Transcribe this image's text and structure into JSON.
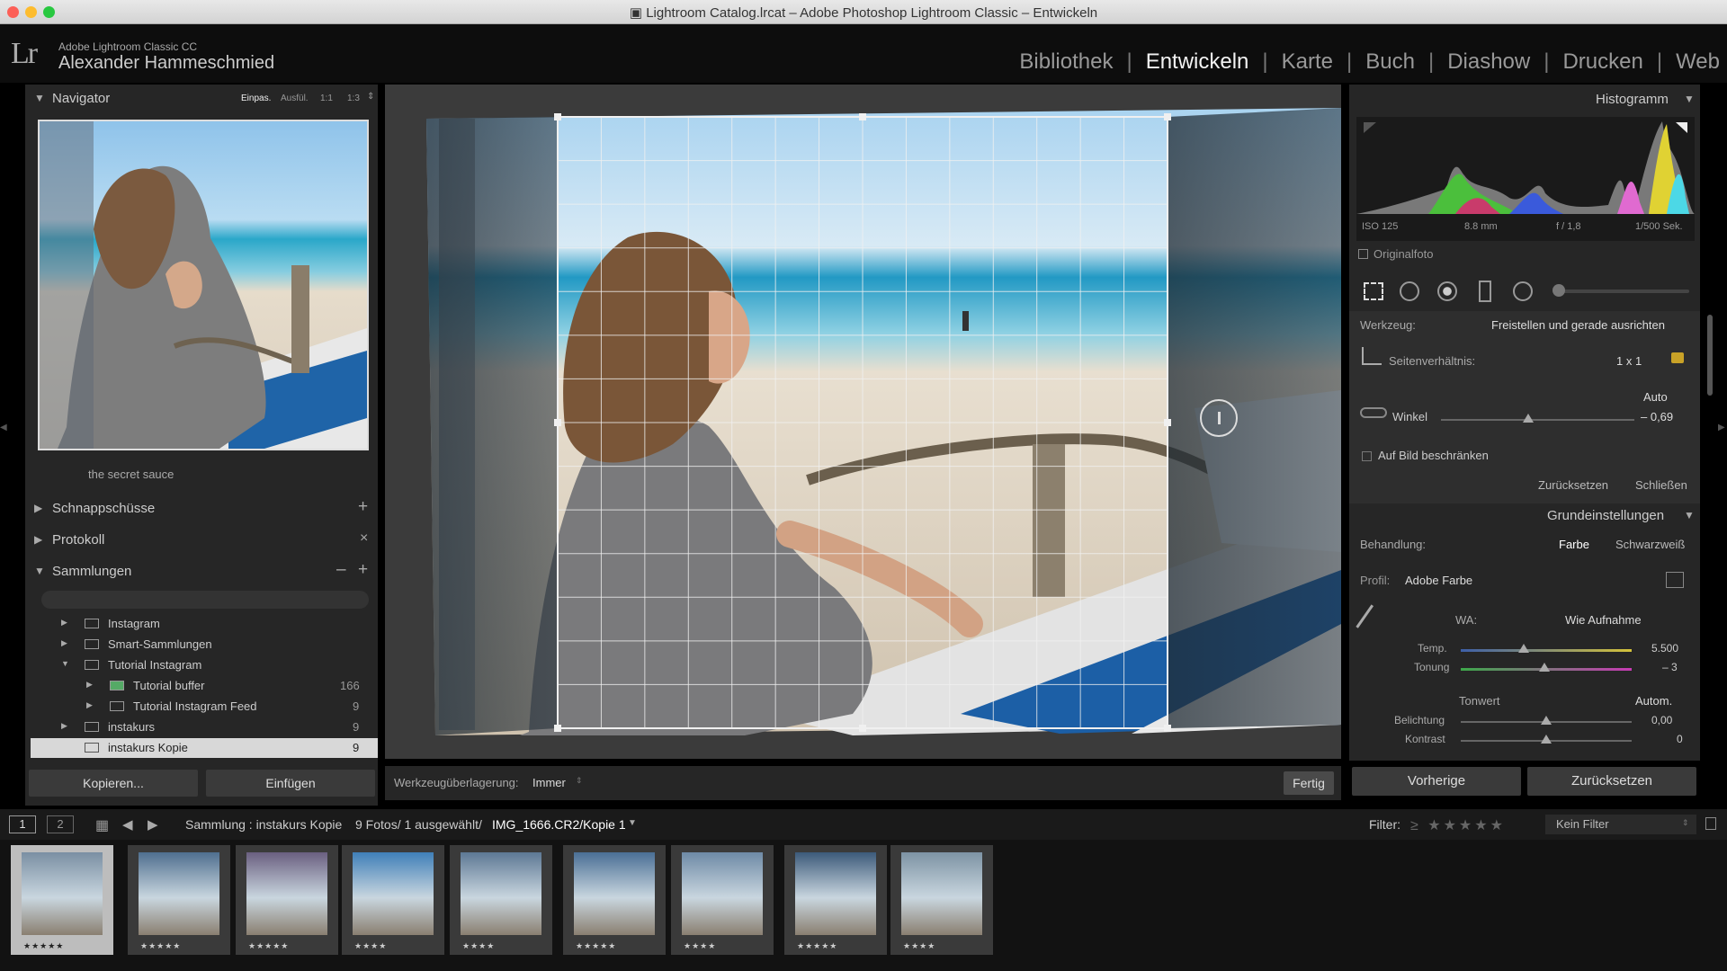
{
  "window": {
    "title": "Lightroom Catalog.lrcat – Adobe Photoshop Lightroom Classic – Entwickeln"
  },
  "identity": {
    "logo": "Lr",
    "product": "Adobe Lightroom Classic CC",
    "user": "Alexander Hammeschmied"
  },
  "modules": [
    "Bibliothek",
    "Entwickeln",
    "Karte",
    "Buch",
    "Diashow",
    "Drucken",
    "Web"
  ],
  "active_module": "Entwickeln",
  "navigator": {
    "title": "Navigator",
    "zoom": [
      "Einpas.",
      "Ausfül.",
      "1:1",
      "1:3"
    ]
  },
  "left": {
    "preset_item": "the secret sauce",
    "snapshots": "Schnappschüsse",
    "history": "Protokoll",
    "collections": "Sammlungen",
    "collection_items": [
      {
        "label": "Instagram",
        "count": ""
      },
      {
        "label": "Smart-Sammlungen",
        "count": ""
      },
      {
        "label": "Tutorial Instagram",
        "count": ""
      },
      {
        "label": "Tutorial buffer",
        "count": "166"
      },
      {
        "label": "Tutorial Instagram Feed",
        "count": "9"
      },
      {
        "label": "instakurs",
        "count": "9"
      },
      {
        "label": "instakurs Kopie",
        "count": "9"
      }
    ],
    "copy_btn": "Kopieren...",
    "paste_btn": "Einfügen"
  },
  "toolbar": {
    "overlay_label": "Werkzeugüberlagerung:",
    "overlay_value": "Immer",
    "done_btn": "Fertig"
  },
  "histogram": {
    "title": "Histogramm",
    "iso": "ISO 125",
    "focal": "8.8 mm",
    "aperture": "f / 1,8",
    "shutter": "1/500 Sek.",
    "original": "Originalfoto"
  },
  "crop": {
    "tool_label": "Werkzeug:",
    "tool_value": "Freistellen und gerade ausrichten",
    "aspect_label": "Seitenverhältnis:",
    "aspect_value": "1 x 1",
    "auto": "Auto",
    "angle_label": "Winkel",
    "angle_value": "– 0,69",
    "angle_level": 0.45,
    "constrain": "Auf Bild beschränken",
    "reset": "Zurücksetzen",
    "close": "Schließen"
  },
  "basic": {
    "title": "Grundeinstellungen",
    "treatment_label": "Behandlung:",
    "color": "Farbe",
    "bw": "Schwarzweiß",
    "profile_label": "Profil:",
    "profile_value": "Adobe Farbe",
    "wb_label": "WA:",
    "wb_value": "Wie Aufnahme",
    "temp_label": "Temp.",
    "temp_value": "5.500",
    "temp_level": 0.37,
    "tint_label": "Tonung",
    "tint_value": "– 3",
    "tint_level": 0.49,
    "tone_label": "Tonwert",
    "auto_tone": "Autom.",
    "exposure_label": "Belichtung",
    "exposure_value": "0,00",
    "exposure_level": 0.5,
    "contrast_label": "Kontrast",
    "contrast_value": "0",
    "contrast_level": 0.5
  },
  "right_buttons": {
    "previous": "Vorherige",
    "reset": "Zurücksetzen"
  },
  "filmbar": {
    "view1": "1",
    "view2": "2",
    "collection_text": "Sammlung : instakurs Kopie",
    "count_text": "9 Fotos/ 1 ausgewählt/",
    "file": "IMG_1666.CR2/Kopie 1",
    "filter_label": "Filter:",
    "filter_value": "Kein Filter"
  },
  "filmstrip": {
    "thumbs": [
      {
        "stars": "★★★★★",
        "color": "#7a8fa3"
      },
      {
        "stars": "★★★★★",
        "color": "#4f6f8f"
      },
      {
        "stars": "★★★★★",
        "color": "#6a5f80"
      },
      {
        "stars": "★★★★",
        "color": "#3f7fb8"
      },
      {
        "stars": "★★★★",
        "color": "#5d7894"
      },
      {
        "stars": "★★★★★",
        "color": "#4a6f95"
      },
      {
        "stars": "★★★★",
        "color": "#6e8aa6"
      },
      {
        "stars": "★★★★★",
        "color": "#3c5a7a"
      },
      {
        "stars": "★★★★",
        "color": "#7d93a4"
      }
    ]
  },
  "colors": {
    "accent": "#f2f2f2",
    "panel": "#2b2b2b",
    "background": "#000000"
  }
}
